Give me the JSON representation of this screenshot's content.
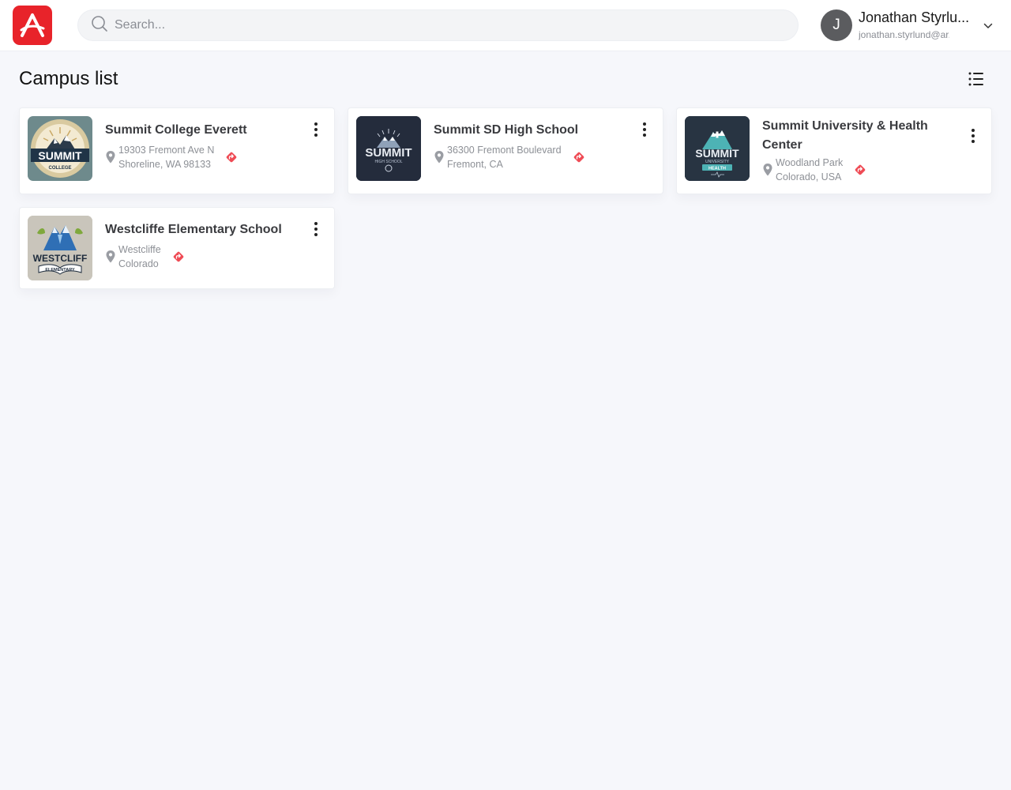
{
  "header": {
    "search_placeholder": "Search...",
    "user": {
      "initial": "J",
      "name": "Jonathan Styrlu...",
      "email": "jonathan.styrlund@ar..."
    }
  },
  "page": {
    "title": "Campus list"
  },
  "campuses": [
    {
      "name": "Summit College Everett",
      "address_line1": "19303 Fremont Ave N",
      "address_line2": "Shoreline, WA 98133",
      "logo_text": "SUMMIT",
      "logo_subtext": "COLLEGE"
    },
    {
      "name": "Summit SD High School",
      "address_line1": "36300 Fremont Boulevard",
      "address_line2": "Fremont, CA",
      "logo_text": "SUMMIT",
      "logo_subtext": "HIGH SCHOOL"
    },
    {
      "name": "Summit University & Health Center",
      "address_line1": "Woodland Park",
      "address_line2": "Colorado, USA",
      "logo_text": "SUMMIT",
      "logo_subtext": "UNIVERSITY",
      "logo_subtext2": "HEALTH"
    },
    {
      "name": "Westcliffe Elementary School",
      "address_line1": "Westcliffe",
      "address_line2": "Colorado",
      "logo_text": "WESTCLIFF",
      "logo_subtext": "ELEMENTARY"
    }
  ],
  "colors": {
    "brand_red": "#e8232a",
    "direction_red": "#ef4b55",
    "page_bg": "#f6f7fb"
  },
  "icons": {
    "app_logo": "app-logo-icon",
    "search": "search-icon",
    "chevron": "chevron-down-icon",
    "list_view": "list-view-icon",
    "more": "more-vertical-icon",
    "location": "location-pin-icon",
    "directions": "directions-icon"
  }
}
